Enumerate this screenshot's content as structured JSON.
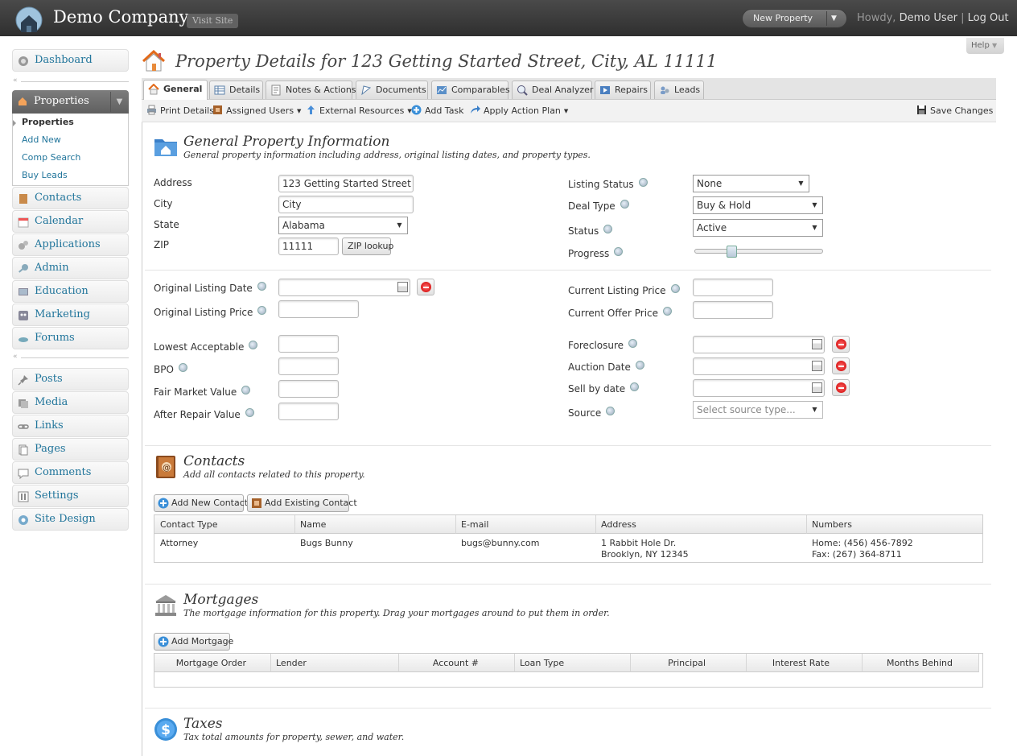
{
  "header": {
    "site_name": "Demo Company",
    "visit_site": "Visit Site",
    "new_property": "New Property",
    "howdy": "Howdy,",
    "user": "Demo User",
    "separator": "|",
    "logout": "Log Out"
  },
  "sidebar": {
    "dashboard": "Dashboard",
    "properties": "Properties",
    "properties_sub": [
      "Properties",
      "Add New",
      "Comp Search",
      "Buy Leads"
    ],
    "group1": [
      "Contacts",
      "Calendar",
      "Applications",
      "Admin",
      "Education",
      "Marketing",
      "Forums"
    ],
    "group2": [
      "Posts",
      "Media",
      "Links",
      "Pages",
      "Comments",
      "Settings",
      "Site Design"
    ],
    "collapse_glyph": "«"
  },
  "help": "Help",
  "page_title": "Property Details for 123 Getting Started Street, City, AL 11111",
  "tabs": [
    "General",
    "Details",
    "Notes & Actions",
    "Documents",
    "Comparables",
    "Deal Analyzer",
    "Repairs",
    "Leads"
  ],
  "toolbar": {
    "print": "Print Details",
    "assigned": "Assigned Users",
    "external": "External Resources",
    "add_task": "Add Task",
    "action_plan": "Apply Action Plan",
    "save": "Save Changes"
  },
  "general": {
    "title": "General Property Information",
    "desc": "General property information including address, original listing dates, and property types.",
    "address_label": "Address",
    "address_value": "123 Getting Started Street",
    "city_label": "City",
    "city_value": "City",
    "state_label": "State",
    "state_value": "Alabama",
    "zip_label": "ZIP",
    "zip_value": "11111",
    "zip_lookup": "ZIP lookup",
    "listing_status_label": "Listing Status",
    "listing_status_value": "None",
    "deal_type_label": "Deal Type",
    "deal_type_value": "Buy & Hold",
    "status_label": "Status",
    "status_value": "Active",
    "progress_label": "Progress",
    "progress_fraction": 0.27
  },
  "pricing": {
    "original_listing_date": "Original Listing Date",
    "original_listing_price": "Original Listing Price",
    "current_listing_price": "Current Listing Price",
    "current_offer_price": "Current Offer Price",
    "lowest_acceptable": "Lowest Acceptable",
    "bpo": "BPO",
    "fair_market_value": "Fair Market Value",
    "after_repair_value": "After Repair Value",
    "foreclosure": "Foreclosure",
    "auction_date": "Auction Date",
    "sell_by_date": "Sell by date",
    "source": "Source",
    "source_placeholder": "Select source type..."
  },
  "contacts": {
    "title": "Contacts",
    "desc": "Add all contacts related to this property.",
    "add_new": "Add New Contact",
    "add_existing": "Add Existing Contact",
    "columns": [
      "Contact Type",
      "Name",
      "E-mail",
      "Address",
      "Numbers"
    ],
    "row": {
      "type": "Attorney",
      "name": "Bugs Bunny",
      "email": "bugs@bunny.com",
      "address1": "1 Rabbit Hole Dr.",
      "address2": "Brooklyn, NY 12345",
      "home": "Home: (456) 456-7892",
      "fax": "Fax: (267) 364-8711"
    }
  },
  "mortgages": {
    "title": "Mortgages",
    "desc": "The mortgage information for this property. Drag your mortgages around to put them in order.",
    "add": "Add Mortgage",
    "columns": [
      "Mortgage Order",
      "Lender",
      "Account #",
      "Loan Type",
      "Principal",
      "Interest Rate",
      "Months Behind"
    ]
  },
  "taxes": {
    "title": "Taxes",
    "desc": "Tax total amounts for property, sewer, and water."
  },
  "colors": {
    "link": "#21759b",
    "header_bg": "#3a3a3a",
    "delete_red": "#cc0000"
  }
}
